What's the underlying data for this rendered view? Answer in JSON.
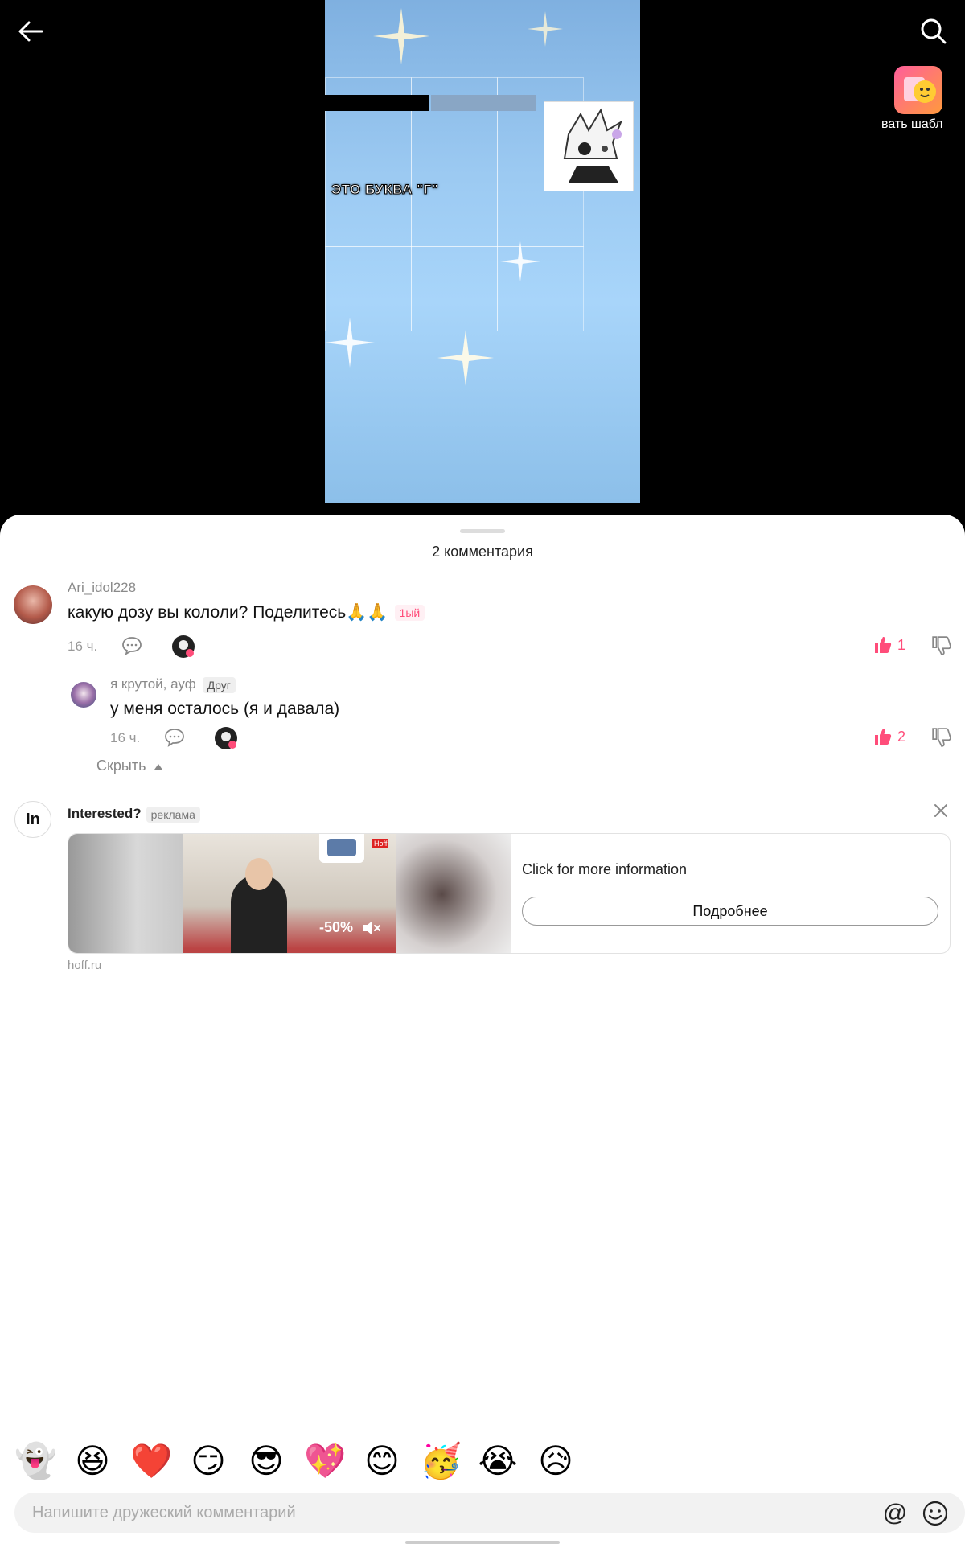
{
  "video": {
    "overlay_caption": "ЭТО БУКВА \"Г\"",
    "template_label": "вать шабл"
  },
  "comments": {
    "title": "2 комментария",
    "items": [
      {
        "username": "Ari_idol228",
        "text": "какую дозу вы кололи? Поделитесь🙏🙏",
        "tag": "1ый",
        "time": "16 ч.",
        "likes": "1"
      },
      {
        "username": "я крутой, ауф",
        "tag": "Друг",
        "text": "у меня осталось (я и давала)",
        "time": "16 ч.",
        "likes": "2"
      }
    ],
    "hide_label": "Скрыть"
  },
  "ad": {
    "avatar_text": "In",
    "title": "Interested?",
    "tag": "реклама",
    "info": "Click for more information",
    "button_label": "Подробнее",
    "domain": "hoff.ru",
    "discount": "-50%",
    "brand": "Hoff"
  },
  "emojis": [
    "👻",
    "😆",
    "❤️",
    "😏",
    "😎",
    "💖",
    "😊",
    "🥳",
    "😭",
    "😥"
  ],
  "composer": {
    "placeholder": "Напишите дружеский комментарий",
    "at_symbol": "@"
  },
  "colors": {
    "accent": "#ff4d7a"
  }
}
